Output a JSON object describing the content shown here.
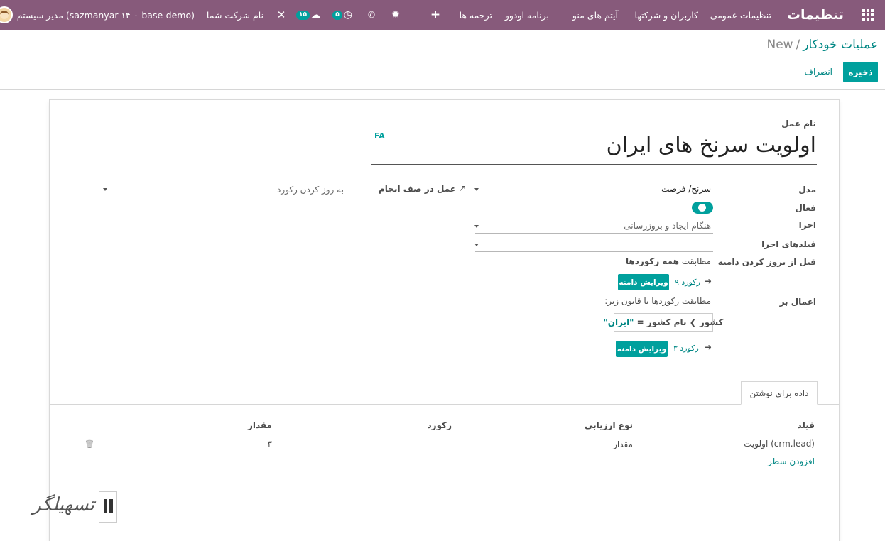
{
  "navbar": {
    "brand": "تنظیمات",
    "menu": [
      "تنظیمات عمومی",
      "کاربران و شرکتها",
      "آیتم های منو",
      "برنامه اودوو",
      "ترجمه ها"
    ],
    "activity_badge": "۵",
    "messages_badge": "۱۵",
    "company_name": "نام شرکت شما",
    "user_name": "مدیر سیستم (sazmanyar-۱۴-۰-base-demo)",
    "icons": [
      "apps-grid-icon",
      "plus-icon",
      "bug-icon",
      "phone-icon",
      "clock-icon",
      "chat-icon",
      "tools-icon"
    ]
  },
  "breadcrumb": {
    "parent": "عملیات خودکار",
    "separator": "/",
    "current": "New"
  },
  "buttons": {
    "save": "ذخیره",
    "discard": "انصراف"
  },
  "form": {
    "name_label": "نام عمل",
    "lang_badge": "FA",
    "name_value": "اولویت سرنخ های ایران",
    "model_label": "مدل",
    "model_value": "سرنخ/ فرصت",
    "active_label": "فعال",
    "active": true,
    "trigger_label": "اجرا",
    "trigger_value": "هنگام ایجاد و بروزرسانی",
    "trigger_fields_label": "فیلدهای اجرا",
    "trigger_fields_value": "",
    "pre_domain_label": "قبل از بروز کردن دامنه",
    "pre_domain_text": "مطابقت همه رکوردها",
    "pre_domain_text_normal": "مطابقت ",
    "pre_domain_text_bold": "همه رکوردها",
    "pre_domain_count": "۹ رکورد",
    "edit_domain_btn": "ویرایش دامنه",
    "apply_on_label": "اعمال بر",
    "apply_on_text": "مطابقت رکوردها با قانون زیر:",
    "domain_path": "کشور ❯ نام کشور",
    "domain_op": "=",
    "domain_value": "\"ایران\"",
    "apply_count": "۳ رکورد",
    "action_label": "عمل در صف انجام",
    "action_value": "به روز کردن رکورد"
  },
  "tabs": [
    "داده برای نوشتن"
  ],
  "table": {
    "headers": [
      "فیلد",
      "نوع ارزیابی",
      "رکورد",
      "مقدار"
    ],
    "rows": [
      {
        "field": "اولویت (crm.lead)",
        "eval_type": "مقدار",
        "record": "",
        "value": "۳"
      }
    ],
    "add_line": "افزودن سطر"
  },
  "colors": {
    "navbar": "#875a7b",
    "primary": "#00a09d",
    "link": "#008784"
  }
}
